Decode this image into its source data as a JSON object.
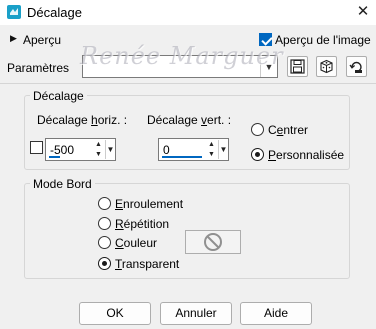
{
  "window": {
    "title": "Décalage",
    "close_icon": "close-icon"
  },
  "preview": {
    "toggle_label": "Aperçu",
    "image_preview_label": "Aperçu de l'image",
    "image_preview_checked": true
  },
  "params": {
    "label": "Paramètres",
    "combo_value": "",
    "watermark": "Renée Marguer"
  },
  "offset_group": {
    "title": "Décalage",
    "horiz": {
      "label_pre": "Décalage ",
      "label_u": "h",
      "label_post": "oriz. :",
      "value": "-500"
    },
    "vert": {
      "label_pre": "Décalage ",
      "label_u": "v",
      "label_post": "ert. :",
      "value": "0"
    },
    "center": {
      "label_pre": "C",
      "label_u": "e",
      "label_post": "ntrer",
      "selected": false
    },
    "custom": {
      "label_pre": "",
      "label_u": "P",
      "label_post": "ersonnalisée",
      "selected": true
    }
  },
  "edge_group": {
    "title": "Mode Bord",
    "options": [
      {
        "u": "E",
        "rest": "nroulement",
        "selected": false
      },
      {
        "u": "R",
        "rest": "épétition",
        "selected": false
      },
      {
        "u": "C",
        "rest": "ouleur",
        "selected": false
      },
      {
        "u": "T",
        "rest": "ransparent",
        "selected": true
      }
    ]
  },
  "buttons": {
    "ok": "OK",
    "cancel": "Annuler",
    "help": "Aide"
  },
  "colors": {
    "accent": "#0067c0",
    "app_icon": "#1aa0c8"
  }
}
